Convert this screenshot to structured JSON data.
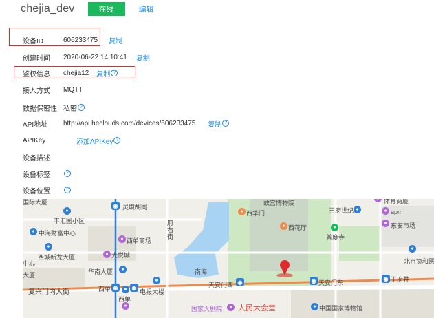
{
  "header": {
    "device_name": "chejia_dev",
    "status_badge": "在线",
    "edit_label": "编辑"
  },
  "fields": {
    "device_id": {
      "label": "设备ID",
      "value": "606233475",
      "action": "复制"
    },
    "created_time": {
      "label": "创建时间",
      "value": "2020-06-22 14:10:41",
      "action": "复制"
    },
    "auth_info": {
      "label": "鉴权信息",
      "value": "chejia12",
      "action": "复制"
    },
    "access_method": {
      "label": "接入方式",
      "value": "MQTT"
    },
    "data_privacy": {
      "label": "数据保密性",
      "value": "私密"
    },
    "api_address": {
      "label": "API地址",
      "value": "http://api.heclouds.com/devices/606233475",
      "action": "复制"
    },
    "api_key": {
      "label": "APIKey",
      "action": "添加APIKey"
    },
    "device_desc": {
      "label": "设备描述"
    },
    "device_tags": {
      "label": "设备标签"
    },
    "device_location": {
      "label": "设备位置"
    }
  },
  "help_icon": "question-circle-icon",
  "colors": {
    "online": "#1bb85d",
    "link": "#1e88e5",
    "highlight": "#e02b2b"
  },
  "map": {
    "labels": {
      "guoji": "国际大厦",
      "lingjing": "灵境胡同",
      "gugong": "故宫博物院",
      "wangfujing": "王府世纪",
      "tiyu": "体育商厦",
      "apm": "apm",
      "dongan": "东安市场",
      "fenghui": "丰汇园小区",
      "xihuamen": "西华门",
      "haimao": "中海财富中心",
      "xidan_mall": "西单商场",
      "fu": "府右街",
      "xihua": "西花厅",
      "pudu": "普度寺",
      "xicheng": "西城新龙大厦",
      "zhong": "中心",
      "dayue": "大悦城",
      "beijing_xiehe": "北京协和医",
      "huanan": "华南大厦",
      "nanhai": "南海",
      "tiananmen_w": "天安门西",
      "tiananmen_e": "天安门东",
      "wangfujing_st": "王府井",
      "dasha": "大厦",
      "fuxingmen": "复兴门内大街",
      "xidan": "西单",
      "dianbao": "电报大楼",
      "xidan2": "西单",
      "guojiadaju": "国家大剧院",
      "renmin": "人民大会堂",
      "bowuguan": "中国国家博物馆"
    }
  }
}
